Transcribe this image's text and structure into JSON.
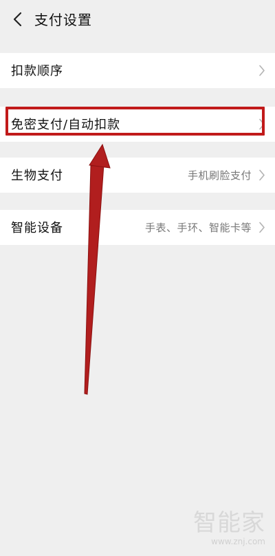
{
  "header": {
    "title": "支付设置"
  },
  "rows": [
    {
      "label": "扣款顺序",
      "value": ""
    },
    {
      "label": "免密支付/自动扣款",
      "value": ""
    },
    {
      "label": "生物支付",
      "value": "手机刷脸支付"
    },
    {
      "label": "智能设备",
      "value": "手表、手环、智能卡等"
    }
  ],
  "watermark": {
    "text": "智能家",
    "url": "www.znj.com"
  },
  "annotation": {
    "highlight_color": "#c11a1a"
  },
  "icons": {
    "back": "back-chevron-icon",
    "row_arrow": "chevron-right-icon"
  }
}
